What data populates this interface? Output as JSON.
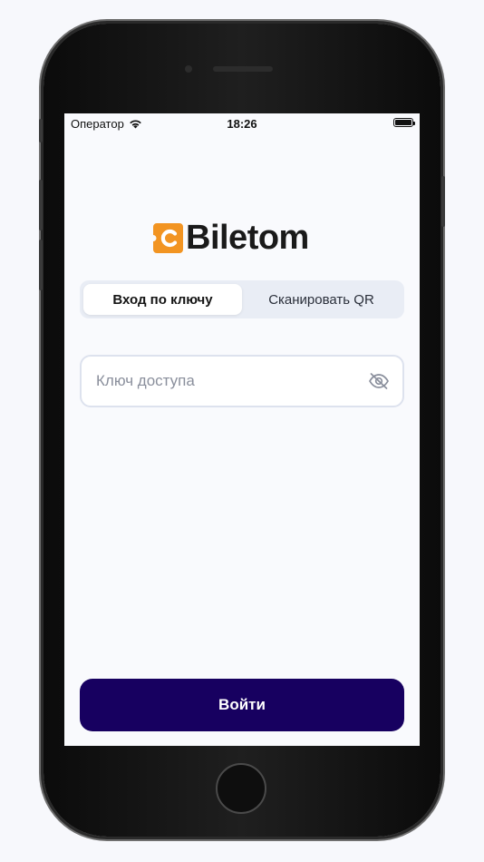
{
  "status_bar": {
    "carrier": "Оператор",
    "time": "18:26",
    "icons": [
      "wifi-icon",
      "battery-icon"
    ]
  },
  "logo": {
    "text": "Biletom",
    "mark_letter": "C",
    "mark_color": "#f29422"
  },
  "tabs": [
    {
      "label": "Вход по ключу",
      "active": true
    },
    {
      "label": "Сканировать QR",
      "active": false
    }
  ],
  "key_field": {
    "value": "",
    "placeholder": "Ключ доступа",
    "icon": "eye-off-icon"
  },
  "login_button": {
    "label": "Войти",
    "color": "#170060"
  }
}
